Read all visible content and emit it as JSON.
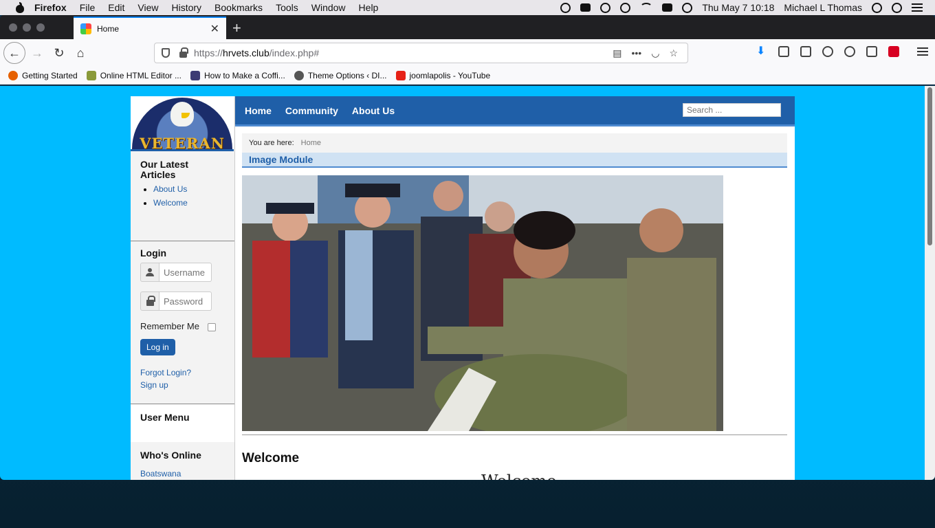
{
  "menubar": {
    "app": "Firefox",
    "menus": [
      "File",
      "Edit",
      "View",
      "History",
      "Bookmarks",
      "Tools",
      "Window",
      "Help"
    ],
    "clock": "Thu May 7  10:18",
    "user": "Michael L Thomas"
  },
  "tab": {
    "title": "Home"
  },
  "urlbar": {
    "url_prefix": "https://",
    "url_host": "hrvets.club",
    "url_path": "/index.php#"
  },
  "bookmarks": [
    {
      "label": "Getting Started",
      "color": "#e66000"
    },
    {
      "label": "Online HTML Editor ...",
      "color": "#8a9a3a"
    },
    {
      "label": "How to Make a Coffi...",
      "color": "#3d3b74"
    },
    {
      "label": "Theme Options ‹ DI...",
      "color": "#555555"
    },
    {
      "label": "joomlapolis - YouTube",
      "color": "#e62117"
    }
  ],
  "site": {
    "logo_word": "VETERAN",
    "nav": [
      "Home",
      "Community",
      "About Us"
    ],
    "search_placeholder": "Search ...",
    "breadcrumb_label": "You are here:",
    "breadcrumb_home": "Home",
    "module_title": "Image Module",
    "heading": "Welcome",
    "subheading": "Welcome"
  },
  "sidebar": {
    "latest_title": "Our Latest Articles",
    "latest_items": [
      "About Us",
      "Welcome"
    ],
    "login_title": "Login",
    "username_placeholder": "Username",
    "password_placeholder": "Password",
    "remember_label": "Remember Me",
    "login_button": "Log in",
    "forgot_link": "Forgot Login?",
    "signup_link": "Sign up",
    "user_menu_title": "User Menu",
    "online_title": "Who's Online",
    "online_user": "Boatswana"
  },
  "colors": {
    "page_bg": "#00bbff",
    "brand_blue": "#1f5fa8",
    "light_blue": "#d0e2f3"
  }
}
